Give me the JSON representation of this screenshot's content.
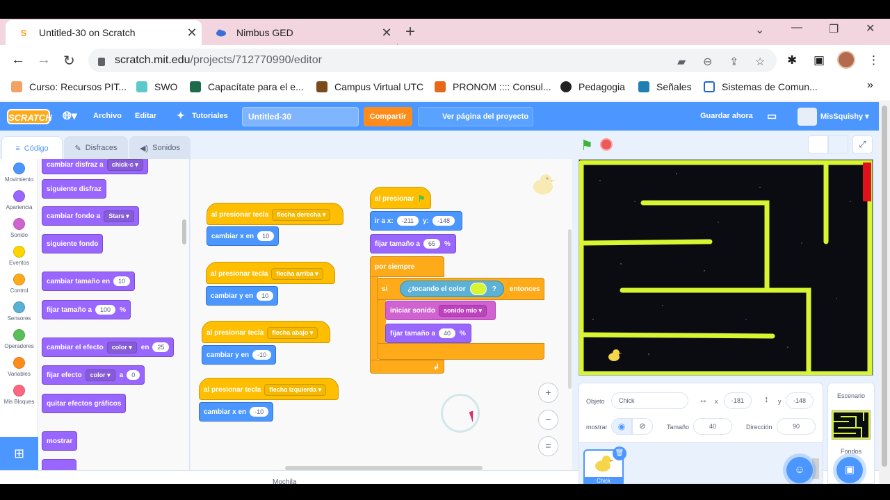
{
  "browser": {
    "tabs": [
      {
        "title": "Untitled-30 on Scratch",
        "active": true
      },
      {
        "title": "Nimbus GED",
        "active": false
      }
    ],
    "url_host": "scratch.mit.edu",
    "url_path": "/projects/712770990/editor",
    "bookmarks": [
      "Curso: Recursos PIT...",
      "SWO",
      "Capacítate para el e...",
      "Campus Virtual UTC",
      "PRONOM :::: Consul...",
      "Pedagogia",
      "Señales",
      "Sistemas de Comun..."
    ],
    "more_bookmarks": "»"
  },
  "scratch": {
    "logo": "SCRATCH",
    "menu": {
      "file": "Archivo",
      "edit": "Editar",
      "tutorials": "Tutoriales",
      "project_title": "Untitled-30",
      "share": "Compartir",
      "see_project": "Ver página del proyecto",
      "save_now": "Guardar ahora",
      "username": "MisSquishy"
    },
    "editor_tabs": [
      "Código",
      "Disfraces",
      "Sonidos"
    ],
    "categories": [
      {
        "label": "Movimiento",
        "color": "#4c97ff"
      },
      {
        "label": "Apariencia",
        "color": "#9966ff"
      },
      {
        "label": "Sonido",
        "color": "#cf63cf"
      },
      {
        "label": "Eventos",
        "color": "#ffd500"
      },
      {
        "label": "Control",
        "color": "#ffab19"
      },
      {
        "label": "Sensores",
        "color": "#5cb1d6"
      },
      {
        "label": "Operadores",
        "color": "#59c059"
      },
      {
        "label": "Variables",
        "color": "#ff8c1a"
      },
      {
        "label": "Mis Bloques",
        "color": "#ff6680"
      }
    ],
    "palette": {
      "switch_costume": "cambiar disfraz a",
      "switch_costume_value": "chick-c",
      "next_costume": "siguiente disfraz",
      "switch_backdrop": "cambiar fondo a",
      "switch_backdrop_value": "Stars",
      "next_backdrop": "siguiente fondo",
      "change_size": "cambiar tamaño en",
      "change_size_value": "10",
      "set_size": "fijar tamaño a",
      "set_size_value": "100",
      "percent": "%",
      "change_effect": "cambiar el efecto",
      "change_effect_dd": "color",
      "by": "en",
      "change_effect_value": "25",
      "set_effect": "fijar efecto",
      "set_effect_dd": "color",
      "to": "a",
      "set_effect_value": "0",
      "clear_effects": "quitar efectos gráficos",
      "show": "mostrar"
    },
    "scripts": {
      "key_press": "al presionar tecla",
      "right": "flecha derecha",
      "up": "flecha arriba",
      "down": "flecha abajo",
      "left": "flecha izquierda",
      "change_x": "cambiar x en",
      "change_y": "cambiar y en",
      "right_val": "10",
      "up_val": "10",
      "down_val": "-10",
      "left_val": "-10",
      "when_flag": "al presionar",
      "goto_x": "ir a x:",
      "goto_x_val": "-211",
      "goto_y": "y:",
      "goto_y_val": "-148",
      "set_size": "fijar tamaño a",
      "set_size_val": "65",
      "set_size_val2": "40",
      "percent": "%",
      "forever": "por siempre",
      "if": "si",
      "touching_color": "¿tocando el color",
      "touching_q": "?",
      "then": "entonces",
      "start_sound": "iniciar sonido",
      "sound_name": "sonido mio"
    },
    "zoom": {
      "in": "+",
      "out": "−",
      "reset": "="
    },
    "status": "Mochila",
    "sprite": {
      "object_label": "Objeto",
      "name": "Chick",
      "x_label": "x",
      "x": "-181",
      "y_label": "y",
      "y": "-148",
      "show_label": "mostrar",
      "size_label": "Tamaño",
      "size": "40",
      "direction_label": "Dirección",
      "direction": "90",
      "thumb_name": "Chick"
    },
    "stage_pane": {
      "title": "Escenario",
      "backdrops_label": "Fondos"
    }
  },
  "colors": {
    "scratch_blue": "#4c97ff",
    "maze_wall": "#d8f531",
    "goal": "#e0111a",
    "touch_color": "#d8f531"
  }
}
